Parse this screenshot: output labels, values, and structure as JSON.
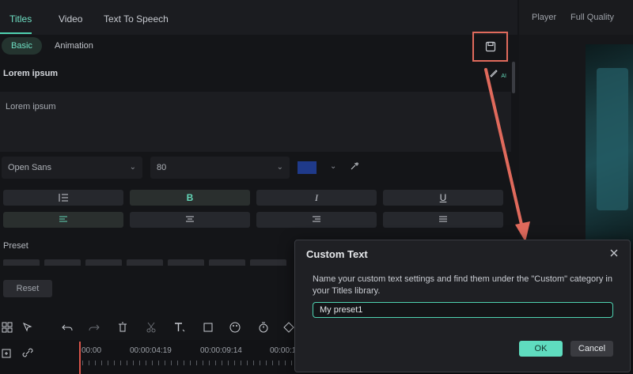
{
  "tabs": {
    "titles": "Titles",
    "video": "Video",
    "tts": "Text To Speech"
  },
  "subtabs": {
    "basic": "Basic",
    "animation": "Animation"
  },
  "right": {
    "player": "Player",
    "quality": "Full Quality"
  },
  "text_title": "Lorem ipsum",
  "text_body": "Lorem ipsum",
  "ai_badge": "AI",
  "font": {
    "family": "Open Sans",
    "size": "80",
    "color": "#1f3a8a"
  },
  "format": {
    "bold": "B",
    "italic": "I",
    "underline": "U"
  },
  "preset_label": "Preset",
  "reset_label": "Reset",
  "timecodes": [
    "00:00",
    "00:00:04:19",
    "00:00:09:14",
    "00:00:1"
  ],
  "dialog": {
    "title": "Custom Text",
    "message": "Name your custom text settings and find them under the \"Custom\" category in your Titles library.",
    "input_value": "My preset1",
    "ok": "OK",
    "cancel": "Cancel"
  },
  "colors": {
    "accent": "#4fd2b1",
    "highlight": "#e06a5c",
    "ok_button": "#5fdcbf"
  }
}
